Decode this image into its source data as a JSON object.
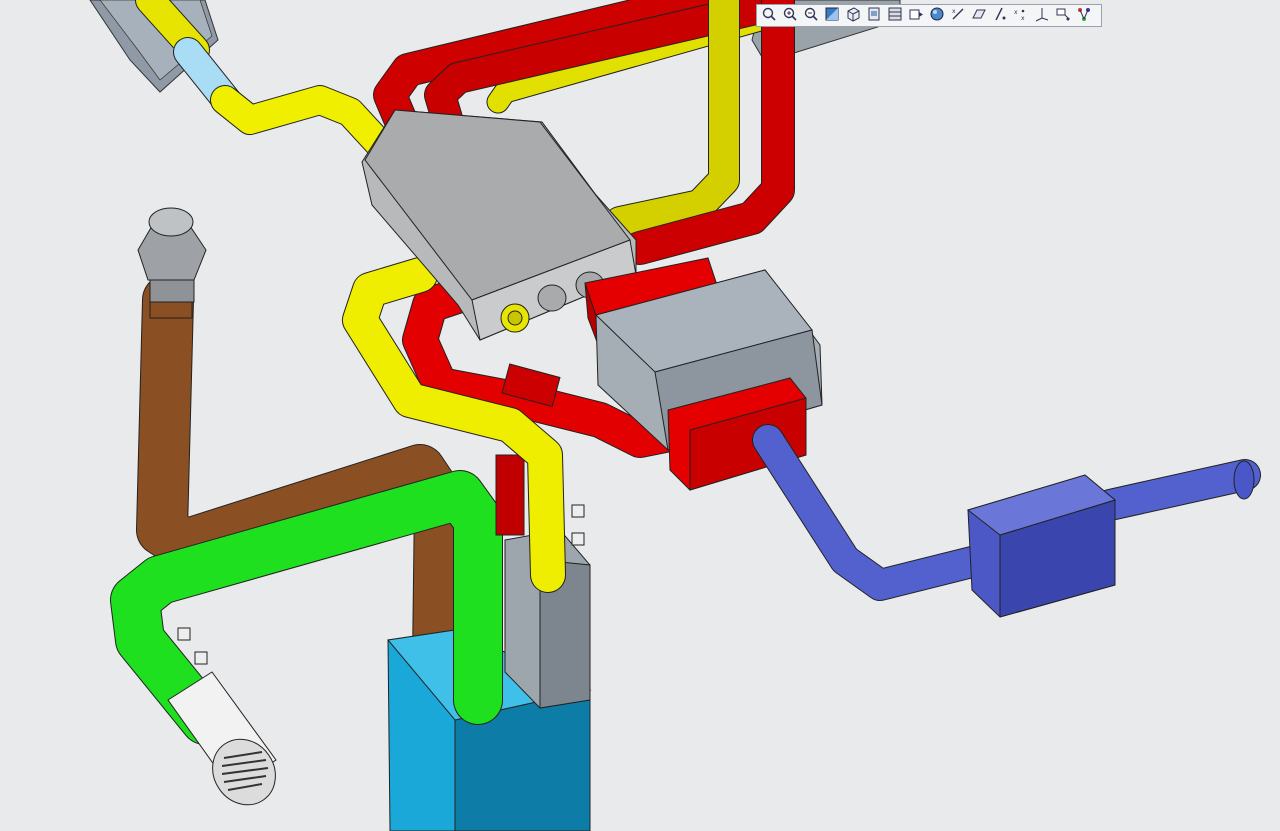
{
  "viewport": {
    "background": "#e9eaec",
    "pipe_colors": {
      "exhaust_yellow": "#e8e800",
      "supply_red": "#dd0000",
      "dark_red": "#b30000",
      "fresh_green": "#1ee01e",
      "flue_brown": "#8a4f22",
      "outdoor_blue": "#5563cc",
      "light_blue": "#a8ddf5",
      "heater_cyan": "#19a8d8",
      "unit_gray": "#b9bcbf"
    }
  },
  "toolbar": {
    "buttons": [
      {
        "icon": "zoom-fit-icon"
      },
      {
        "icon": "zoom-in-icon"
      },
      {
        "icon": "zoom-out-icon"
      },
      {
        "icon": "shading-icon"
      },
      {
        "icon": "view-orientation-icon"
      },
      {
        "icon": "saved-views-icon"
      },
      {
        "icon": "layers-icon"
      },
      {
        "icon": "display-style-icon"
      },
      {
        "icon": "appearance-icon"
      },
      {
        "icon": "datum-display-icon"
      },
      {
        "icon": "plane-display-icon"
      },
      {
        "icon": "axis-display-icon"
      },
      {
        "icon": "point-display-icon"
      },
      {
        "icon": "csys-display-icon"
      },
      {
        "icon": "annotation-display-icon"
      },
      {
        "icon": "spin-center-icon"
      }
    ]
  }
}
